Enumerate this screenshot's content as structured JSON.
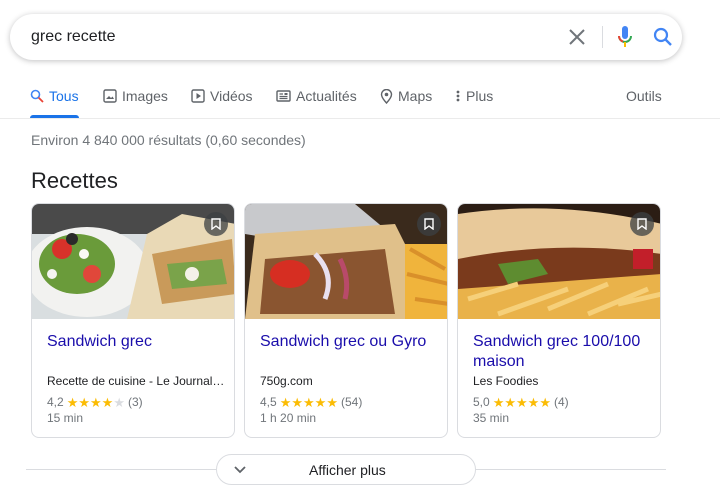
{
  "search": {
    "query": "grec recette"
  },
  "tabs": [
    {
      "label": "Tous",
      "icon": "search-icon",
      "active": true
    },
    {
      "label": "Images",
      "icon": "image-icon"
    },
    {
      "label": "Vidéos",
      "icon": "video-icon"
    },
    {
      "label": "Actualités",
      "icon": "news-icon"
    },
    {
      "label": "Maps",
      "icon": "map-pin-icon"
    },
    {
      "label": "Plus",
      "icon": "more-vert-icon"
    }
  ],
  "tools_label": "Outils",
  "result_stats": "Environ 4 840 000 résultats (0,60 secondes)",
  "section_title": "Recettes",
  "recipes": [
    {
      "title": "Sandwich grec",
      "source": "Recette de cuisine - Le Journal…",
      "rating": "4,2",
      "stars": 4.2,
      "reviews": "(3)",
      "time": "15 min"
    },
    {
      "title": "Sandwich grec ou Gyro",
      "source": "750g.com",
      "rating": "4,5",
      "stars": 4.5,
      "reviews": "(54)",
      "time": "1 h 20 min"
    },
    {
      "title": "Sandwich grec 100/100 maison",
      "source": "Les Foodies",
      "rating": "5,0",
      "stars": 5.0,
      "reviews": "(4)",
      "time": "35 min"
    }
  ],
  "show_more_label": "Afficher plus",
  "colors": {
    "accent": "#1a73e8",
    "link": "#1a0dab",
    "star": "#fbbc04"
  }
}
